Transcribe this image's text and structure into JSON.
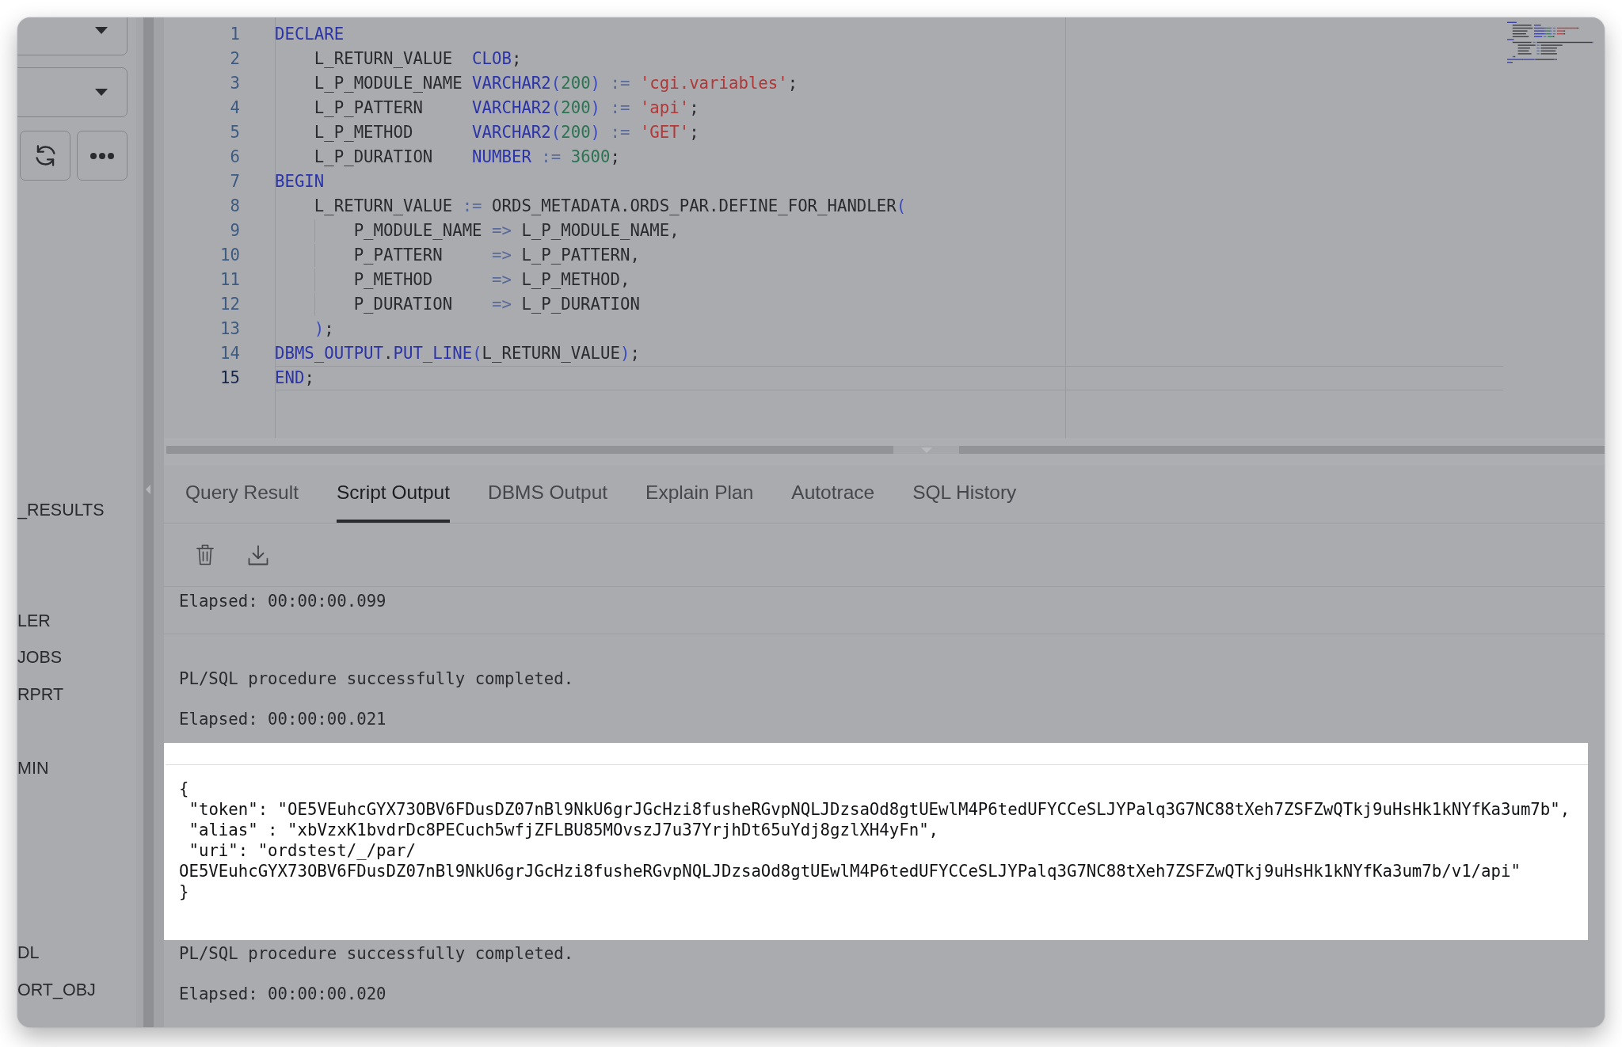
{
  "sidebar": {
    "buttons": [
      {
        "kind": "refresh"
      },
      {
        "kind": "more"
      }
    ],
    "items": [
      "_RESULTS",
      "LER",
      "JOBS",
      "RPRT",
      "MIN",
      "DL",
      "ORT_OBJ"
    ]
  },
  "editor": {
    "lines": [
      {
        "number": "1",
        "current": false,
        "segments": [
          {
            "kind": "keyword",
            "text": "DECLARE"
          }
        ]
      },
      {
        "number": "2",
        "current": false,
        "segments": [
          {
            "kind": "plain",
            "text": "    L_RETURN_VALUE  "
          },
          {
            "kind": "keyword",
            "text": "CLOB"
          },
          {
            "kind": "plain",
            "text": ";"
          }
        ]
      },
      {
        "number": "3",
        "current": false,
        "segments": [
          {
            "kind": "plain",
            "text": "    L_P_MODULE_NAME "
          },
          {
            "kind": "keyword",
            "text": "VARCHAR2"
          },
          {
            "kind": "paren",
            "text": "("
          },
          {
            "kind": "number",
            "text": "200"
          },
          {
            "kind": "paren",
            "text": ")"
          },
          {
            "kind": "operator",
            "text": " := "
          },
          {
            "kind": "string",
            "text": "'cgi.variables'"
          },
          {
            "kind": "plain",
            "text": ";"
          }
        ]
      },
      {
        "number": "4",
        "current": false,
        "segments": [
          {
            "kind": "plain",
            "text": "    L_P_PATTERN     "
          },
          {
            "kind": "keyword",
            "text": "VARCHAR2"
          },
          {
            "kind": "paren",
            "text": "("
          },
          {
            "kind": "number",
            "text": "200"
          },
          {
            "kind": "paren",
            "text": ")"
          },
          {
            "kind": "operator",
            "text": " := "
          },
          {
            "kind": "string",
            "text": "'api'"
          },
          {
            "kind": "plain",
            "text": ";"
          }
        ]
      },
      {
        "number": "5",
        "current": false,
        "segments": [
          {
            "kind": "plain",
            "text": "    L_P_METHOD      "
          },
          {
            "kind": "keyword",
            "text": "VARCHAR2"
          },
          {
            "kind": "paren",
            "text": "("
          },
          {
            "kind": "number",
            "text": "200"
          },
          {
            "kind": "paren",
            "text": ")"
          },
          {
            "kind": "operator",
            "text": " := "
          },
          {
            "kind": "string",
            "text": "'GET'"
          },
          {
            "kind": "plain",
            "text": ";"
          }
        ]
      },
      {
        "number": "6",
        "current": false,
        "segments": [
          {
            "kind": "plain",
            "text": "    L_P_DURATION    "
          },
          {
            "kind": "keyword",
            "text": "NUMBER"
          },
          {
            "kind": "operator",
            "text": " := "
          },
          {
            "kind": "number",
            "text": "3600"
          },
          {
            "kind": "plain",
            "text": ";"
          }
        ]
      },
      {
        "number": "7",
        "current": false,
        "segments": [
          {
            "kind": "keyword",
            "text": "BEGIN"
          }
        ]
      },
      {
        "number": "8",
        "current": false,
        "segments": [
          {
            "kind": "plain",
            "text": "    L_RETURN_VALUE "
          },
          {
            "kind": "operator",
            "text": ":="
          },
          {
            "kind": "plain",
            "text": " ORDS_METADATA.ORDS_PAR.DEFINE_FOR_HANDLER"
          },
          {
            "kind": "paren",
            "text": "("
          }
        ]
      },
      {
        "number": "9",
        "current": false,
        "segments": [
          {
            "kind": "plain",
            "text": "        P_MODULE_NAME "
          },
          {
            "kind": "operator",
            "text": "=>"
          },
          {
            "kind": "plain",
            "text": " L_P_MODULE_NAME,"
          }
        ]
      },
      {
        "number": "10",
        "current": false,
        "segments": [
          {
            "kind": "plain",
            "text": "        P_PATTERN     "
          },
          {
            "kind": "operator",
            "text": "=>"
          },
          {
            "kind": "plain",
            "text": " L_P_PATTERN,"
          }
        ]
      },
      {
        "number": "11",
        "current": false,
        "segments": [
          {
            "kind": "plain",
            "text": "        P_METHOD      "
          },
          {
            "kind": "operator",
            "text": "=>"
          },
          {
            "kind": "plain",
            "text": " L_P_METHOD,"
          }
        ]
      },
      {
        "number": "12",
        "current": false,
        "segments": [
          {
            "kind": "plain",
            "text": "        P_DURATION    "
          },
          {
            "kind": "operator",
            "text": "=>"
          },
          {
            "kind": "plain",
            "text": " L_P_DURATION"
          }
        ]
      },
      {
        "number": "13",
        "current": false,
        "segments": [
          {
            "kind": "paren",
            "text": "    )"
          },
          {
            "kind": "plain",
            "text": ";"
          }
        ]
      },
      {
        "number": "14",
        "current": false,
        "segments": [
          {
            "kind": "keyword",
            "text": "DBMS_OUTPUT"
          },
          {
            "kind": "plain",
            "text": "."
          },
          {
            "kind": "keyword",
            "text": "PUT_LINE"
          },
          {
            "kind": "paren",
            "text": "("
          },
          {
            "kind": "plain",
            "text": "L_RETURN_VALUE"
          },
          {
            "kind": "paren",
            "text": ")"
          },
          {
            "kind": "plain",
            "text": ";"
          }
        ]
      },
      {
        "number": "15",
        "current": true,
        "segments": [
          {
            "kind": "keyword",
            "text": "END"
          },
          {
            "kind": "plain",
            "text": ";"
          }
        ]
      }
    ]
  },
  "tabs": [
    {
      "label": "Query Result",
      "selected": false
    },
    {
      "label": "Script Output",
      "selected": true
    },
    {
      "label": "DBMS Output",
      "selected": false
    },
    {
      "label": "Explain Plan",
      "selected": false
    },
    {
      "label": "Autotrace",
      "selected": false
    },
    {
      "label": "SQL History",
      "selected": false
    }
  ],
  "output": {
    "toolbar": [
      {
        "kind": "clear"
      },
      {
        "kind": "download"
      }
    ],
    "blocks": [
      {
        "highlighted": false,
        "lines": [
          "Elapsed: 00:00:00.099"
        ]
      },
      {
        "highlighted": false,
        "lines": [
          "PL/SQL procedure successfully completed.",
          "Elapsed: 00:00:00.021"
        ]
      },
      {
        "highlighted": true,
        "lines": [
          "{",
          " \"token\": \"OE5VEuhcGYX73OBV6FDusDZ07nBl9NkU6grJGcHzi8fusheRGvpNQLJDzsaOd8gtUEwlM4P6tedUFYCCeSLJYPalq3G7NC88tXeh7ZSFZwQTkj9uHsHk1kNYfKa3um7b\",",
          " \"alias\" : \"xbVzxK1bvdrDc8PECuch5wfjZFLBU85MOvszJ7u37YrjhDt65uYdj8gzlXH4yFn\",",
          " \"uri\": \"ordstest/_/par/",
          "OE5VEuhcGYX73OBV6FDusDZ07nBl9NkU6grJGcHzi8fusheRGvpNQLJDzsaOd8gtUEwlM4P6tedUFYCCeSLJYPalq3G7NC88tXeh7ZSFZwQTkj9uHsHk1kNYfKa3um7b/v1/api\"",
          "}"
        ]
      },
      {
        "highlighted": false,
        "lines": [
          "PL/SQL procedure successfully completed.",
          "Elapsed: 00:00:00.020"
        ]
      }
    ]
  }
}
